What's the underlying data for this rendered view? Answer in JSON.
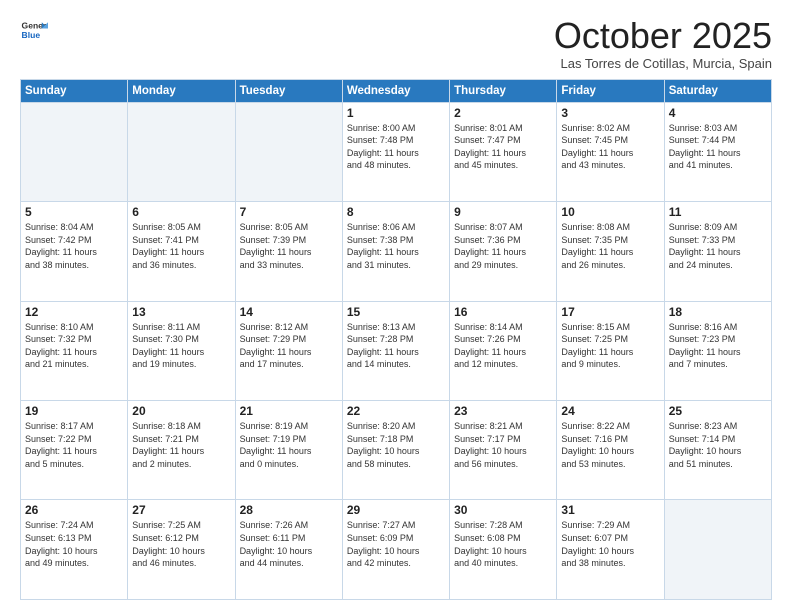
{
  "logo": {
    "general": "General",
    "blue": "Blue"
  },
  "header": {
    "month": "October 2025",
    "location": "Las Torres de Cotillas, Murcia, Spain"
  },
  "days_of_week": [
    "Sunday",
    "Monday",
    "Tuesday",
    "Wednesday",
    "Thursday",
    "Friday",
    "Saturday"
  ],
  "weeks": [
    [
      {
        "day": "",
        "info": ""
      },
      {
        "day": "",
        "info": ""
      },
      {
        "day": "",
        "info": ""
      },
      {
        "day": "1",
        "info": "Sunrise: 8:00 AM\nSunset: 7:48 PM\nDaylight: 11 hours\nand 48 minutes."
      },
      {
        "day": "2",
        "info": "Sunrise: 8:01 AM\nSunset: 7:47 PM\nDaylight: 11 hours\nand 45 minutes."
      },
      {
        "day": "3",
        "info": "Sunrise: 8:02 AM\nSunset: 7:45 PM\nDaylight: 11 hours\nand 43 minutes."
      },
      {
        "day": "4",
        "info": "Sunrise: 8:03 AM\nSunset: 7:44 PM\nDaylight: 11 hours\nand 41 minutes."
      }
    ],
    [
      {
        "day": "5",
        "info": "Sunrise: 8:04 AM\nSunset: 7:42 PM\nDaylight: 11 hours\nand 38 minutes."
      },
      {
        "day": "6",
        "info": "Sunrise: 8:05 AM\nSunset: 7:41 PM\nDaylight: 11 hours\nand 36 minutes."
      },
      {
        "day": "7",
        "info": "Sunrise: 8:05 AM\nSunset: 7:39 PM\nDaylight: 11 hours\nand 33 minutes."
      },
      {
        "day": "8",
        "info": "Sunrise: 8:06 AM\nSunset: 7:38 PM\nDaylight: 11 hours\nand 31 minutes."
      },
      {
        "day": "9",
        "info": "Sunrise: 8:07 AM\nSunset: 7:36 PM\nDaylight: 11 hours\nand 29 minutes."
      },
      {
        "day": "10",
        "info": "Sunrise: 8:08 AM\nSunset: 7:35 PM\nDaylight: 11 hours\nand 26 minutes."
      },
      {
        "day": "11",
        "info": "Sunrise: 8:09 AM\nSunset: 7:33 PM\nDaylight: 11 hours\nand 24 minutes."
      }
    ],
    [
      {
        "day": "12",
        "info": "Sunrise: 8:10 AM\nSunset: 7:32 PM\nDaylight: 11 hours\nand 21 minutes."
      },
      {
        "day": "13",
        "info": "Sunrise: 8:11 AM\nSunset: 7:30 PM\nDaylight: 11 hours\nand 19 minutes."
      },
      {
        "day": "14",
        "info": "Sunrise: 8:12 AM\nSunset: 7:29 PM\nDaylight: 11 hours\nand 17 minutes."
      },
      {
        "day": "15",
        "info": "Sunrise: 8:13 AM\nSunset: 7:28 PM\nDaylight: 11 hours\nand 14 minutes."
      },
      {
        "day": "16",
        "info": "Sunrise: 8:14 AM\nSunset: 7:26 PM\nDaylight: 11 hours\nand 12 minutes."
      },
      {
        "day": "17",
        "info": "Sunrise: 8:15 AM\nSunset: 7:25 PM\nDaylight: 11 hours\nand 9 minutes."
      },
      {
        "day": "18",
        "info": "Sunrise: 8:16 AM\nSunset: 7:23 PM\nDaylight: 11 hours\nand 7 minutes."
      }
    ],
    [
      {
        "day": "19",
        "info": "Sunrise: 8:17 AM\nSunset: 7:22 PM\nDaylight: 11 hours\nand 5 minutes."
      },
      {
        "day": "20",
        "info": "Sunrise: 8:18 AM\nSunset: 7:21 PM\nDaylight: 11 hours\nand 2 minutes."
      },
      {
        "day": "21",
        "info": "Sunrise: 8:19 AM\nSunset: 7:19 PM\nDaylight: 11 hours\nand 0 minutes."
      },
      {
        "day": "22",
        "info": "Sunrise: 8:20 AM\nSunset: 7:18 PM\nDaylight: 10 hours\nand 58 minutes."
      },
      {
        "day": "23",
        "info": "Sunrise: 8:21 AM\nSunset: 7:17 PM\nDaylight: 10 hours\nand 56 minutes."
      },
      {
        "day": "24",
        "info": "Sunrise: 8:22 AM\nSunset: 7:16 PM\nDaylight: 10 hours\nand 53 minutes."
      },
      {
        "day": "25",
        "info": "Sunrise: 8:23 AM\nSunset: 7:14 PM\nDaylight: 10 hours\nand 51 minutes."
      }
    ],
    [
      {
        "day": "26",
        "info": "Sunrise: 7:24 AM\nSunset: 6:13 PM\nDaylight: 10 hours\nand 49 minutes."
      },
      {
        "day": "27",
        "info": "Sunrise: 7:25 AM\nSunset: 6:12 PM\nDaylight: 10 hours\nand 46 minutes."
      },
      {
        "day": "28",
        "info": "Sunrise: 7:26 AM\nSunset: 6:11 PM\nDaylight: 10 hours\nand 44 minutes."
      },
      {
        "day": "29",
        "info": "Sunrise: 7:27 AM\nSunset: 6:09 PM\nDaylight: 10 hours\nand 42 minutes."
      },
      {
        "day": "30",
        "info": "Sunrise: 7:28 AM\nSunset: 6:08 PM\nDaylight: 10 hours\nand 40 minutes."
      },
      {
        "day": "31",
        "info": "Sunrise: 7:29 AM\nSunset: 6:07 PM\nDaylight: 10 hours\nand 38 minutes."
      },
      {
        "day": "",
        "info": ""
      }
    ]
  ]
}
